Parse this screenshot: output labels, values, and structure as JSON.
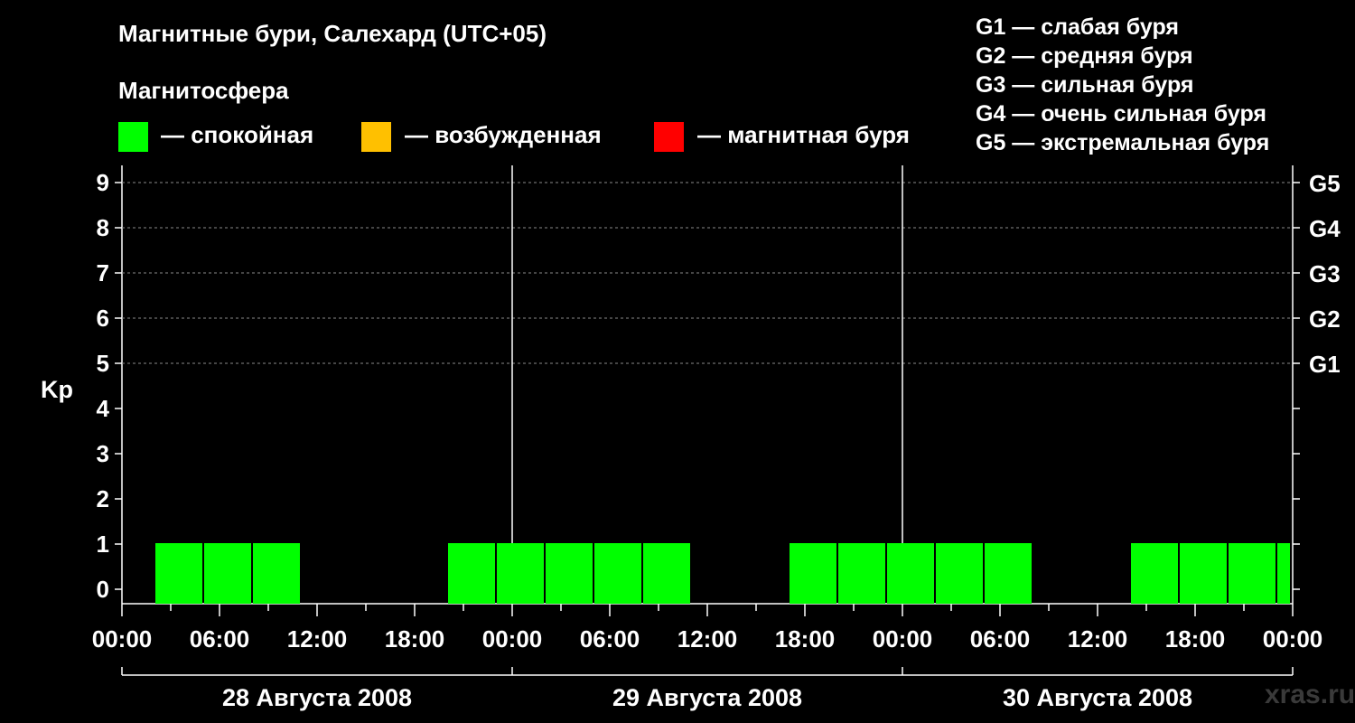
{
  "title": "Магнитные бури, Салехард (UTC+05)",
  "magnetosphere_label": "Магнитосфера",
  "legend": [
    {
      "label": "— спокойная",
      "color": "#00ff00"
    },
    {
      "label": "— возбужденная",
      "color": "#ffc000"
    },
    {
      "label": "— магнитная буря",
      "color": "#ff0000"
    }
  ],
  "g_legend": [
    "G1 — слабая буря",
    "G2 — средняя буря",
    "G3 — сильная буря",
    "G4 — очень сильная буря",
    "G5 — экстремальная буря"
  ],
  "watermark": "xras.ru",
  "chart_data": {
    "type": "bar",
    "ylabel": "Kp",
    "ylim": [
      0,
      9
    ],
    "y_ticks": [
      "0",
      "1",
      "2",
      "3",
      "4",
      "5",
      "6",
      "7",
      "8",
      "9"
    ],
    "right_ticks": [
      {
        "kp": 5,
        "label": "G1"
      },
      {
        "kp": 6,
        "label": "G2"
      },
      {
        "kp": 7,
        "label": "G3"
      },
      {
        "kp": 8,
        "label": "G4"
      },
      {
        "kp": 9,
        "label": "G5"
      }
    ],
    "x_tick_labels": [
      "00:00",
      "06:00",
      "12:00",
      "18:00",
      "00:00",
      "06:00",
      "12:00",
      "18:00",
      "00:00",
      "06:00",
      "12:00",
      "18:00",
      "00:00"
    ],
    "days": [
      "28 Августа 2008",
      "29 Августа 2008",
      "30 Августа 2008"
    ],
    "interval_hours": 3,
    "colors": {
      "quiet": "#00ff00",
      "active": "#ffc000",
      "storm": "#ff0000"
    },
    "bars": [
      {
        "start": "28.08 02:00",
        "kp": 1,
        "state": "quiet"
      },
      {
        "start": "28.08 05:00",
        "kp": 1,
        "state": "quiet"
      },
      {
        "start": "28.08 08:00",
        "kp": 1,
        "state": "quiet"
      },
      {
        "start": "28.08 11:00",
        "kp": 0,
        "state": "quiet"
      },
      {
        "start": "28.08 14:00",
        "kp": 0,
        "state": "quiet"
      },
      {
        "start": "28.08 17:00",
        "kp": 0,
        "state": "quiet"
      },
      {
        "start": "28.08 20:00",
        "kp": 1,
        "state": "quiet"
      },
      {
        "start": "28.08 23:00",
        "kp": 1,
        "state": "quiet"
      },
      {
        "start": "29.08 02:00",
        "kp": 1,
        "state": "quiet"
      },
      {
        "start": "29.08 05:00",
        "kp": 1,
        "state": "quiet"
      },
      {
        "start": "29.08 08:00",
        "kp": 1,
        "state": "quiet"
      },
      {
        "start": "29.08 11:00",
        "kp": 0,
        "state": "quiet"
      },
      {
        "start": "29.08 14:00",
        "kp": 0,
        "state": "quiet"
      },
      {
        "start": "29.08 17:00",
        "kp": 1,
        "state": "quiet"
      },
      {
        "start": "29.08 20:00",
        "kp": 1,
        "state": "quiet"
      },
      {
        "start": "29.08 23:00",
        "kp": 1,
        "state": "quiet"
      },
      {
        "start": "30.08 02:00",
        "kp": 1,
        "state": "quiet"
      },
      {
        "start": "30.08 05:00",
        "kp": 1,
        "state": "quiet"
      },
      {
        "start": "30.08 08:00",
        "kp": 0,
        "state": "quiet"
      },
      {
        "start": "30.08 11:00",
        "kp": 0,
        "state": "quiet"
      },
      {
        "start": "30.08 14:00",
        "kp": 1,
        "state": "quiet"
      },
      {
        "start": "30.08 17:00",
        "kp": 1,
        "state": "quiet"
      },
      {
        "start": "30.08 20:00",
        "kp": 1,
        "state": "quiet"
      },
      {
        "start": "30.08 23:00",
        "kp": 1,
        "state": "quiet"
      }
    ],
    "grid": true,
    "legend_position": "top"
  }
}
